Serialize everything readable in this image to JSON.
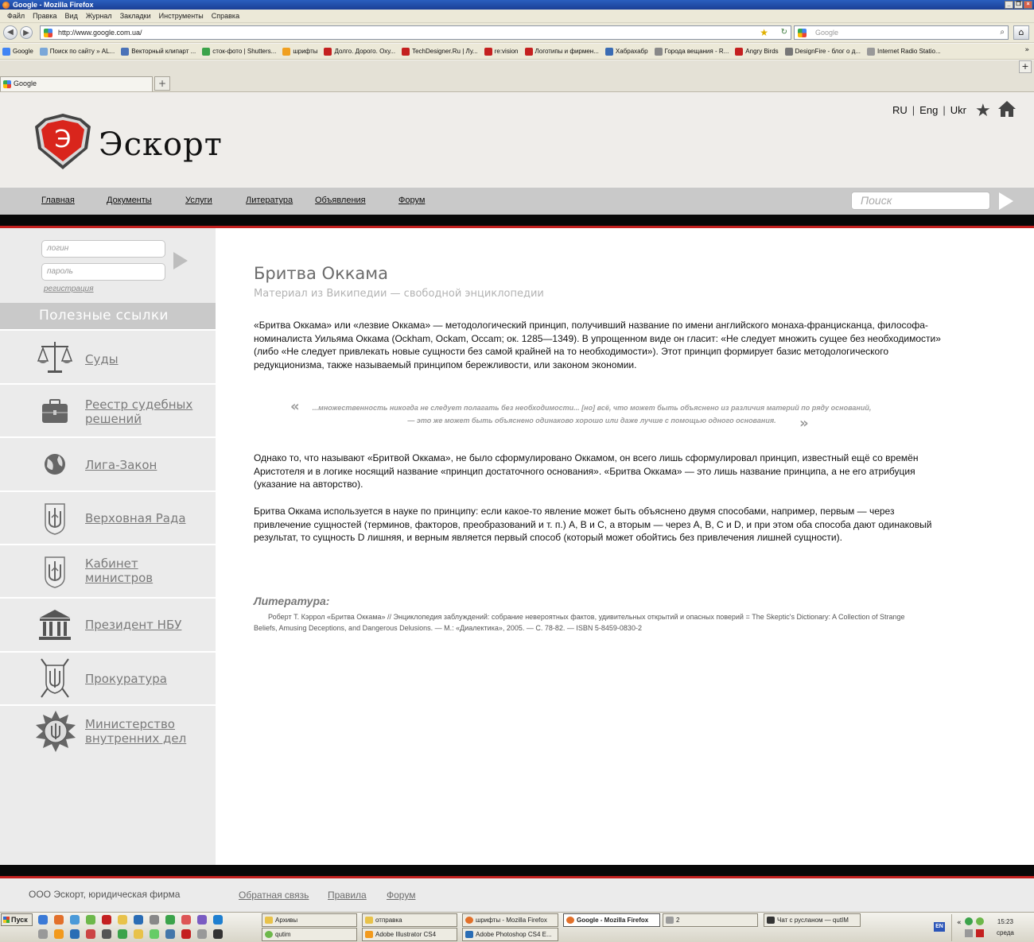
{
  "browser": {
    "window_title": "Google - Mozilla Firefox",
    "menu": [
      "Файл",
      "Правка",
      "Вид",
      "Журнал",
      "Закладки",
      "Инструменты",
      "Справка"
    ],
    "url": "http://www.google.com.ua/",
    "search_placeholder": "Google",
    "bookmarks": [
      {
        "label": "Google",
        "color": "#4285f4"
      },
      {
        "label": "Поиск по сайту » AL...",
        "color": "#7aa7d8"
      },
      {
        "label": "Векторный клипарт ...",
        "color": "#4a72b8"
      },
      {
        "label": "сток-фото | Shutters...",
        "color": "#3ba34a"
      },
      {
        "label": "шрифты",
        "color": "#f0a020"
      },
      {
        "label": "Долго. Дорого. Оху...",
        "color": "#c42020"
      },
      {
        "label": "TechDesigner.Ru | Лу...",
        "color": "#c42020"
      },
      {
        "label": "re:vision",
        "color": "#c42020"
      },
      {
        "label": "Логотипы и фирмен...",
        "color": "#c42020"
      },
      {
        "label": "Хабрахабр",
        "color": "#3a6cb4"
      },
      {
        "label": "Города вещания - R...",
        "color": "#888888"
      },
      {
        "label": "Angry Birds",
        "color": "#c42020"
      },
      {
        "label": "DesignFire - блог о д...",
        "color": "#777777"
      },
      {
        "label": "Internet Radio Statio...",
        "color": "#999999"
      }
    ],
    "bookmarks_more": "»",
    "tab_label": "Google",
    "new_tab": "+"
  },
  "site": {
    "logo_letter": "Э",
    "logo_text": "Эскорт",
    "languages": [
      "RU",
      "Eng",
      "Ukr"
    ],
    "lang_sep": "|",
    "nav": [
      "Главная",
      "Документы",
      "Услуги",
      "Литература",
      "Объявления",
      "Форум"
    ],
    "search_placeholder": "Поиск",
    "login_placeholder": "логин",
    "password_placeholder": "пароль",
    "register": "регистрация",
    "links_heading": "Полезные ссылки",
    "links": [
      {
        "line1": "Суды",
        "line2": ""
      },
      {
        "line1": "Реестр судебных",
        "line2": "решений"
      },
      {
        "line1": "Лига-Закон",
        "line2": ""
      },
      {
        "line1": "Верховная Рада",
        "line2": ""
      },
      {
        "line1": "Кабинет",
        "line2": "министров"
      },
      {
        "line1": "Президент НБУ",
        "line2": ""
      },
      {
        "line1": "Прокуратура",
        "line2": ""
      },
      {
        "line1": "Министерство",
        "line2": "внутренних дел"
      }
    ],
    "accent_red": "#c4201f",
    "nav_gray": "#c9c9c9"
  },
  "article": {
    "title": "Бритва Оккама",
    "subtitle": "Материал из Википедии — свободной энциклопедии",
    "p1": "«Бритва Оккама» или «лезвие Оккама» — методологический принцип, получивший название по имени английского монаха-францисканца, философа-номиналиста Уильяма Оккама (Ockham, Ockam, Occam; ок. 1285—1349). В упрощенном виде он гласит: «Не следует множить сущее без необходимости» (либо «Не следует привлекать новые сущности без самой крайней на то необходимости»). Этот принцип формирует базис методологического редукционизма, также называемый принципом бережливости, или законом экономии.",
    "quote_open": "«",
    "quote": "...множественность никогда не следует полагать без необходимости... [но] всё, что может быть объяснено из различия материй по ряду оснований, — это же может быть объяснено одинаково хорошо или даже лучше с помощью одного основания.",
    "quote_close": "»",
    "p2": "Однако то, что называют «Бритвой Оккама», не было сформулировано Оккамом, он всего лишь сформулировал принцип, известный ещё со времён Аристотеля и в логике носящий название «принцип достаточного основания». «Бритва Оккама» — это лишь название принципа, а не его атрибуция (указание на авторство).",
    "p3": "Бритва Оккама используется в науке по принципу: если какое-то явление может быть объяснено двумя способами, например, первым — через привлечение сущностей (терминов, факторов, преобразований и т. п.) А, В и С, а вторым — через А, В, С и D, и при этом оба способа дают одинаковый результат, то сущность D лишняя, и верным является первый способ (который может обойтись без привлечения лишней сущности).",
    "lit_title": "Литература:",
    "lit_text": "Роберт Т. Кэррол «Бритва Оккама» // Энциклопедия заблуждений: собрание невероятных фактов, удивительных открытий и опасных поверий = The Skeptic's Dictionary: A Collection of Strange Beliefs, Amusing Deceptions, and Dangerous Delusions. — М.: «Диалектика», 2005. — С. 78-82. — ISBN 5-8459-0830-2"
  },
  "footer": {
    "company": "ООО Эскорт, юридическая фирма",
    "links": [
      "Обратная связь",
      "Правила",
      "Форум"
    ]
  },
  "taskbar": {
    "start": "Пуск",
    "buttons_top": [
      "Архивы",
      "отправка",
      "шрифты - Mozilla Firefox",
      "Google - Mozilla Firefox",
      "2",
      "Чат с русланом — qutIM"
    ],
    "buttons_bottom": [
      "qutim",
      "Adobe Illustrator CS4",
      "Adobe Photoshop CS4 E..."
    ],
    "lang": "EN",
    "time": "15:23",
    "day": "среда"
  }
}
